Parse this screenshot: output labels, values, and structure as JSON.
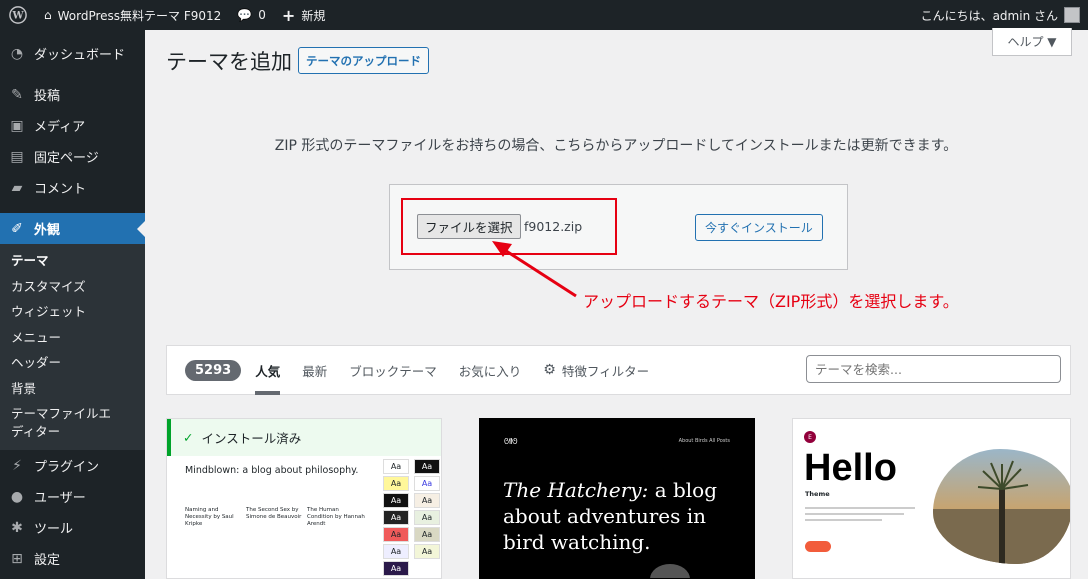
{
  "adminbar": {
    "site_name": "WordPress無料テーマ F9012",
    "comments_count": "0",
    "new_label": "新規",
    "greeting": "こんにちは、admin さん"
  },
  "sidebar": {
    "items": [
      {
        "label": "ダッシュボード",
        "icon": "dashboard-icon"
      },
      {
        "label": "投稿",
        "icon": "pin-icon"
      },
      {
        "label": "メディア",
        "icon": "media-icon"
      },
      {
        "label": "固定ページ",
        "icon": "page-icon"
      },
      {
        "label": "コメント",
        "icon": "comment-icon"
      },
      {
        "label": "外観",
        "icon": "brush-icon"
      }
    ],
    "submenu": [
      "テーマ",
      "カスタマイズ",
      "ウィジェット",
      "メニュー",
      "ヘッダー",
      "背景",
      "テーマファイルエディター"
    ],
    "items_after": [
      {
        "label": "プラグイン",
        "icon": "plugin-icon"
      },
      {
        "label": "ユーザー",
        "icon": "user-icon"
      },
      {
        "label": "ツール",
        "icon": "wrench-icon"
      },
      {
        "label": "設定",
        "icon": "settings-icon"
      }
    ]
  },
  "help_label": "ヘルプ ▼",
  "page": {
    "title": "テーマを追加",
    "upload_button": "テーマのアップロード",
    "upload_description": "ZIP 形式のテーマファイルをお持ちの場合、こちらからアップロードしてインストールまたは更新できます。",
    "file_button": "ファイルを選択",
    "file_name": "f9012.zip",
    "install_button": "今すぐインストール",
    "annotation": "アップロードするテーマ（ZIP形式）を選択します。"
  },
  "filter": {
    "count": "5293",
    "tabs": [
      "人気",
      "最新",
      "ブロックテーマ",
      "お気に入り"
    ],
    "feature_filter": "特徴フィルター",
    "search_placeholder": "テーマを検索..."
  },
  "cards": {
    "card1": {
      "installed": "インストール済み",
      "blog_title": "Mindblown: a blog about philosophy.",
      "col1": "Naming and Necessity by Saul Kripke",
      "col2": "The Second Sex by Simone de Beauvoir",
      "col3": "The Human Condition by Hannah Arendt",
      "aa": "Aa"
    },
    "card2": {
      "nav_logo": "ᘛᘚ",
      "nav_links": "About   Birds   All Posts",
      "headline_italic": "The Hatchery:",
      "headline_rest": "a blog about adventures in bird watching."
    },
    "card3": {
      "logo": "E",
      "hello": "Hello",
      "theme": "Theme"
    }
  },
  "colors": {
    "admin_bg": "#1d2327",
    "accent": "#2271b1",
    "annotation_red": "#e60012",
    "installed_green": "#00a32a"
  }
}
